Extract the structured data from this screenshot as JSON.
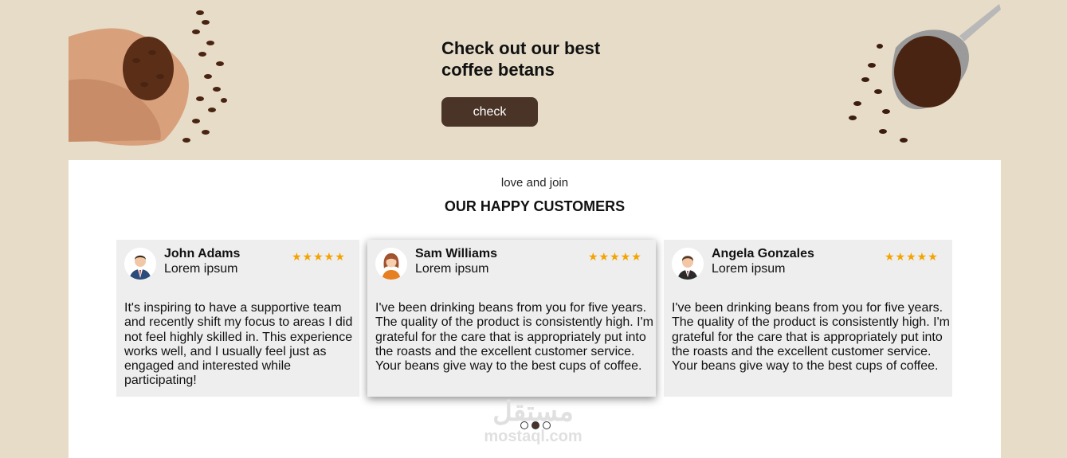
{
  "banner": {
    "title": "Check out our best coffee betans",
    "button_label": "check"
  },
  "testimonials": {
    "eyebrow": "love and join",
    "heading": "OUR HAPPY CUSTOMERS",
    "cards": [
      {
        "name": "John Adams",
        "subtitle": "Lorem ipsum",
        "stars": "★★★★★",
        "rating": 5,
        "text": "It's inspiring to have a supportive team and recently shift my focus to areas I did not feel highly skilled in. This experience works well, and I usually feel just as engaged and interested while participating!"
      },
      {
        "name": "Sam Williams",
        "subtitle": "Lorem ipsum",
        "stars": "★★★★★",
        "rating": 5,
        "text": "I've been drinking beans from you for five years. The quality of the product is consistently high. I'm grateful for the care that is appropriately put into the roasts and the excellent customer service. Your beans give way to the best cups of coffee."
      },
      {
        "name": "Angela Gonzales",
        "subtitle": "Lorem ipsum",
        "stars": "★★★★★",
        "rating": 5,
        "text": "I've been drinking beans from you for five years. The quality of the product is consistently high. I'm grateful for the care that is appropriately put into the roasts and the excellent customer service. Your beans give way to the best cups of coffee."
      }
    ],
    "pagination": {
      "total": 3,
      "active": 2
    }
  },
  "watermark": {
    "arabic": "مستقل",
    "latin": "mostaql.com"
  },
  "colors": {
    "background": "#e6dcc8",
    "button": "#4a3427",
    "star": "#f5a300",
    "card": "#eeeeee"
  }
}
